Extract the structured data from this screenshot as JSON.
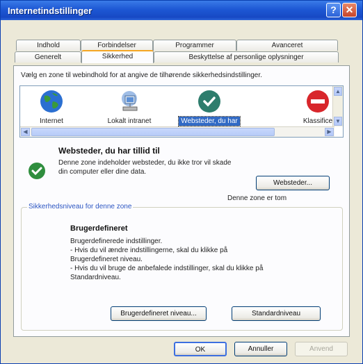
{
  "window": {
    "title": "Internetindstillinger"
  },
  "tabs": {
    "row1": [
      "Indhold",
      "Forbindelser",
      "Programmer",
      "Avanceret"
    ],
    "row2": [
      "Generelt",
      "Sikkerhed",
      "Beskyttelse af personlige oplysninger"
    ],
    "active": "Sikkerhed"
  },
  "instruction": "Vælg en zone til webindhold for at angive de tilhørende sikkerhedsindstillinger.",
  "zones": [
    {
      "label": "Internet",
      "icon": "globe-icon"
    },
    {
      "label": "Lokalt intranet",
      "icon": "network-computer-icon"
    },
    {
      "label": "Websteder, du har",
      "icon": "checkmark-icon",
      "selected": true
    },
    {
      "label": "Klassifice",
      "icon": "restricted-icon"
    }
  ],
  "zone_info": {
    "name": "Websteder, du har tillid til",
    "description": "Denne zone indeholder websteder, du ikke tror vil skade din computer eller dine data.",
    "sites_button": "Websteder...",
    "empty_label": "Denne zone er tom"
  },
  "security_level": {
    "legend": "Sikkerhedsniveau for denne zone",
    "title": "Brugerdefineret",
    "lines": [
      "Brugerdefinerede indstillinger.",
      "- Hvis du vil ændre indstillingerne, skal du klikke på",
      "Brugerdefineret niveau.",
      "- Hvis du vil bruge de anbefalede indstillinger, skal du klikke på",
      "Standardniveau."
    ],
    "custom_button": "Brugerdefineret niveau...",
    "default_button": "Standardniveau"
  },
  "footer": {
    "ok": "OK",
    "cancel": "Annuller",
    "apply": "Anvend"
  },
  "colors": {
    "titlebar": "#1d57d4",
    "selection": "#316ac5",
    "active_tab": "#f5a623"
  }
}
